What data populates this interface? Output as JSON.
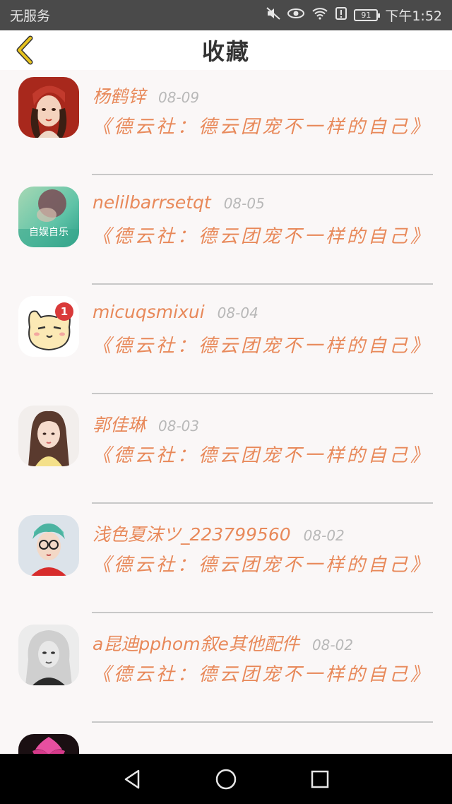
{
  "status_bar": {
    "carrier": "无服务",
    "battery": "91",
    "time": "下午1:52"
  },
  "header": {
    "title": "收藏",
    "back_icon": "chevron-left-icon"
  },
  "items": [
    {
      "name": "杨鹤锌",
      "date": "08-09",
      "title": "《德云社：德云团宠不一样的自己》"
    },
    {
      "name": "nelilbarrsetqt",
      "date": "08-05",
      "title": "《德云社：德云团宠不一样的自己》",
      "avatar_text": "自娱自乐"
    },
    {
      "name": "micuqsmixui",
      "date": "08-04",
      "title": "《德云社：德云团宠不一样的自己》",
      "badge": "1"
    },
    {
      "name": "郭佳琳",
      "date": "08-03",
      "title": "《德云社：德云团宠不一样的自己》"
    },
    {
      "name": "浅色夏沫ツ_223799560",
      "date": "08-02",
      "title": "《德云社：德云团宠不一样的自己》"
    },
    {
      "name": "a昆迪pphom叙e其他配件",
      "date": "08-02",
      "title": "《德云社：德云团宠不一样的自己》"
    }
  ],
  "colors": {
    "accent": "#e8895a",
    "date": "#b8b8b8",
    "divider": "#c8c8c8",
    "status_bar": "#4a4a4a",
    "back_icon": "#e6c21e"
  },
  "nav": {
    "back": "triangle-back-icon",
    "home": "circle-home-icon",
    "recents": "square-recents-icon"
  }
}
